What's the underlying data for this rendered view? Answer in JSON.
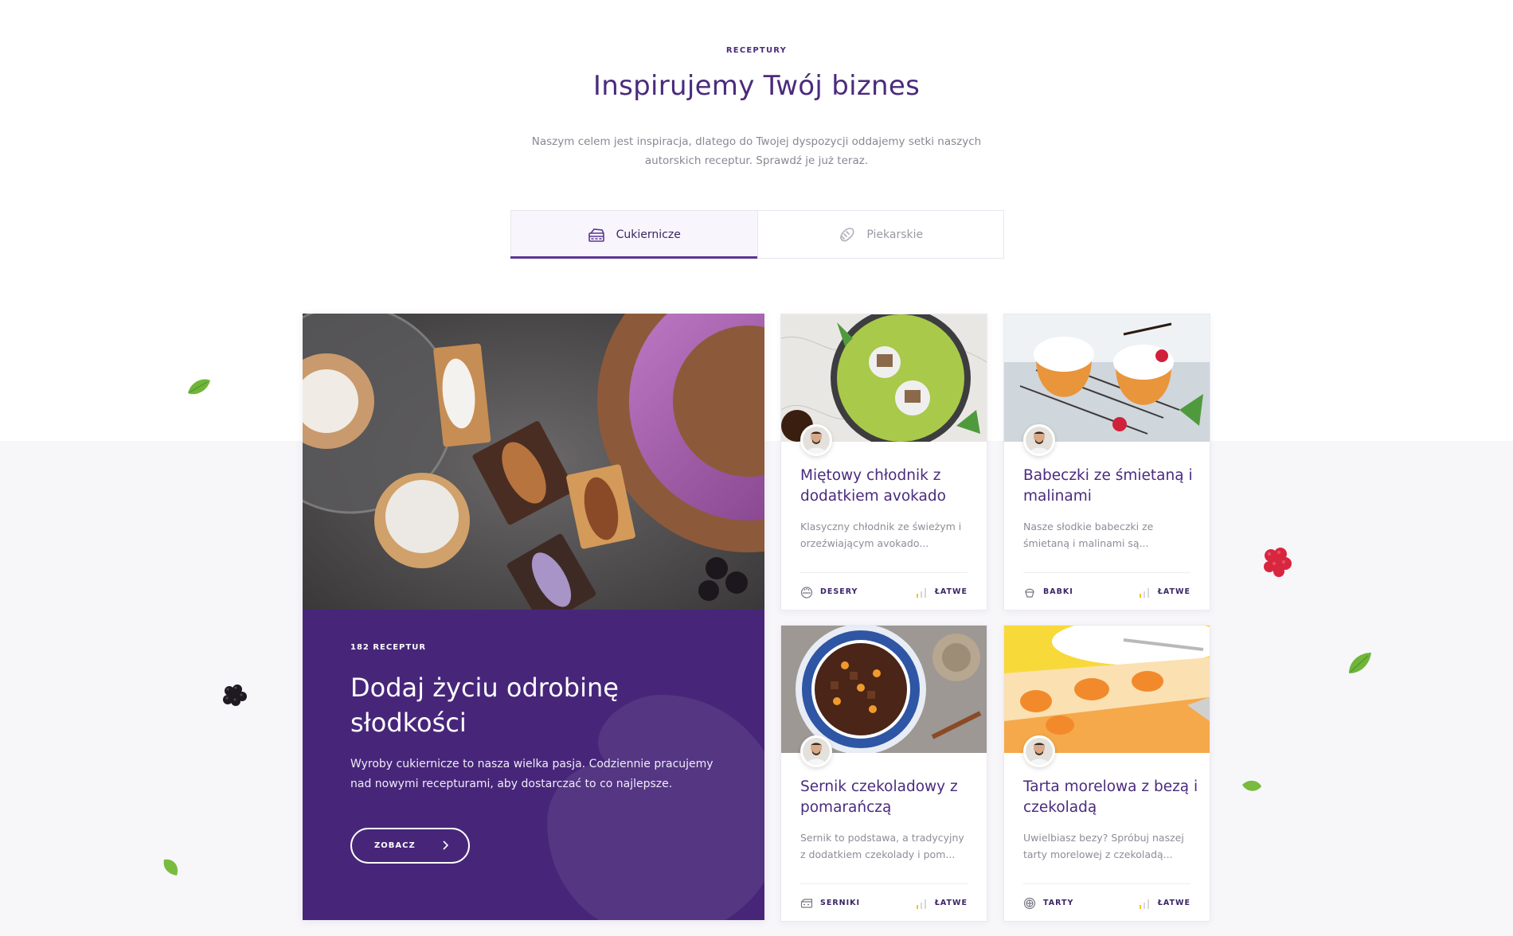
{
  "section": {
    "eyebrow": "RECEPTURY",
    "title": "Inspirujemy Twój biznes",
    "description": "Naszym celem jest inspiracja, dlatego do Twojej dyspozycji oddajemy setki naszych autorskich receptur. Sprawdź je już teraz."
  },
  "tabs": [
    {
      "label": "Cukiernicze",
      "icon": "cake-icon",
      "active": true
    },
    {
      "label": "Piekarskie",
      "icon": "bread-icon",
      "active": false
    }
  ],
  "featured": {
    "count": "182 RECEPTUR",
    "title": "Dodaj życiu odrobinę słodkości",
    "description": "Wyroby cukiernicze to nasza wielka pasja. Codziennie pracujemy nad nowymi recepturami, aby dostarczać to co najlepsze.",
    "button": "ZOBACZ"
  },
  "recipes": [
    {
      "title": "Miętowy chłodnik z dodatkiem avokado",
      "description": "Klasyczny chłodnik ze świeżym i orzeźwiającym avokado...",
      "category": "DESERY",
      "category_icon": "dessert-bowl-icon",
      "difficulty": "ŁATWE"
    },
    {
      "title": "Babeczki ze śmietaną i malinami",
      "description": "Nasze słodkie babeczki ze śmietaną i malinami są...",
      "category": "BABKI",
      "category_icon": "cupcake-icon",
      "difficulty": "ŁATWE"
    },
    {
      "title": "Sernik czekoladowy z pomarańczą",
      "description": "Sernik to podstawa, a tradycyjny z dodatkiem czekolady i pom...",
      "category": "SERNIKI",
      "category_icon": "cheesecake-icon",
      "difficulty": "ŁATWE"
    },
    {
      "title": "Tarta morelowa z bezą i czekoladą",
      "description": "Uwielbiasz bezy? Spróbuj naszej tarty morelowej z czekoladą...",
      "category": "TARTY",
      "category_icon": "tart-icon",
      "difficulty": "ŁATWE"
    }
  ],
  "colors": {
    "brand_purple": "#47267a",
    "accent_purple": "#5b3594",
    "difficulty_yellow": "#f2c12e"
  }
}
